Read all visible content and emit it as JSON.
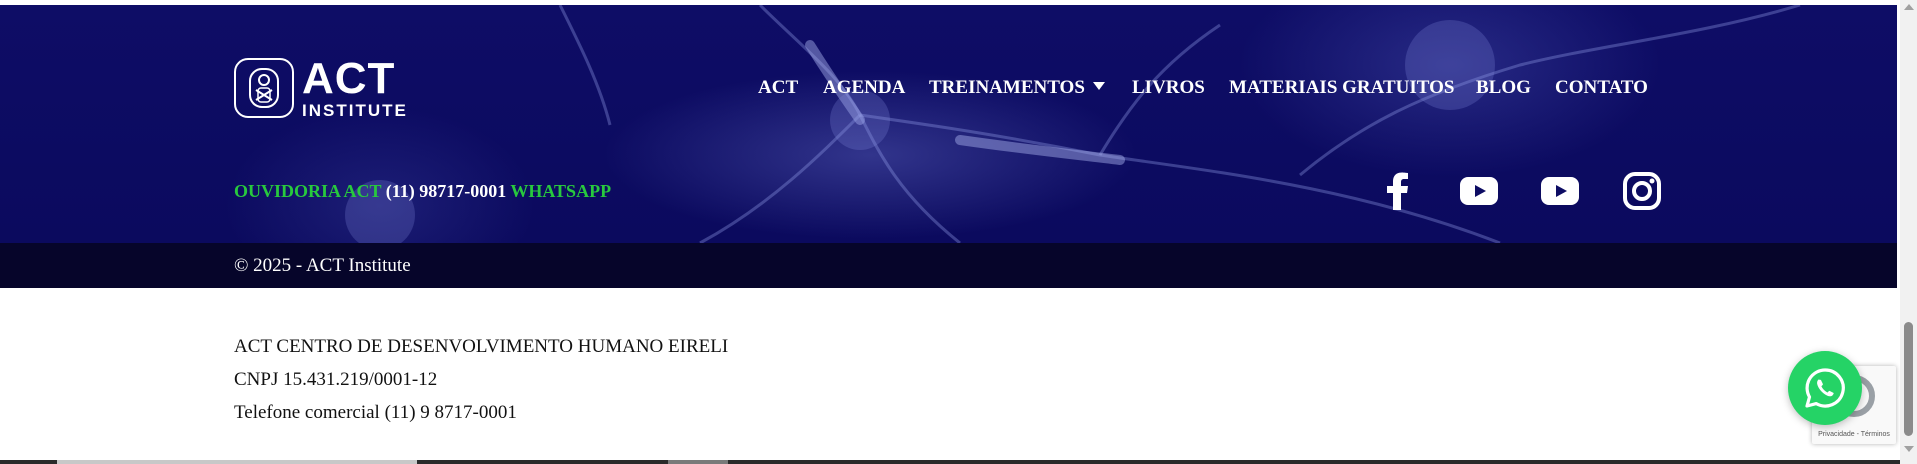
{
  "brand": {
    "logo_main": "ACT",
    "logo_sub": "INSTITUTE"
  },
  "nav": {
    "items": [
      {
        "label": "ACT"
      },
      {
        "label": "AGENDA"
      },
      {
        "label": "TREINAMENTOS",
        "has_dropdown": true
      },
      {
        "label": "LIVROS"
      },
      {
        "label": "MATERIAIS GRATUITOS"
      },
      {
        "label": "BLOG"
      },
      {
        "label": "CONTATO"
      }
    ]
  },
  "contact": {
    "ouvidoria_label": "OUVIDORIA ACT",
    "phone": "(11) 98717-0001",
    "whatsapp_label": "WHATSAPP"
  },
  "social": [
    {
      "icon": "facebook-icon"
    },
    {
      "icon": "youtube-icon"
    },
    {
      "icon": "youtube-icon"
    },
    {
      "icon": "instagram-icon"
    }
  ],
  "footer": {
    "copyright": "© 2025 - ACT Institute"
  },
  "company": {
    "name": "ACT CENTRO DE DESENVOLVIMENTO HUMANO EIRELI",
    "cnpj": "CNPJ 15.431.219/0001-12",
    "phone": "Telefone comercial (11) 9 8717-0001"
  },
  "recaptcha": {
    "label": "Privacidade - Términos"
  },
  "colors": {
    "hero_bg": "#0e0d66",
    "copy_bar": "#06052a",
    "accent_green": "#28c93e",
    "whatsapp_green": "#25d366"
  }
}
